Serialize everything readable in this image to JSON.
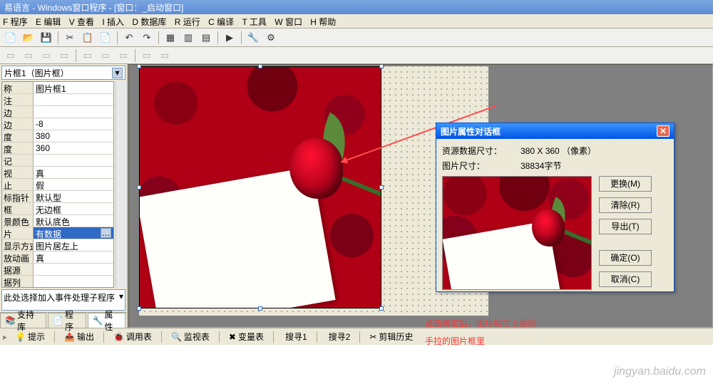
{
  "title": "易语言 - Windows窗口程序 - [窗口：_启动窗口]",
  "menu": [
    "F 程序",
    "E 编辑",
    "V 查看",
    "I 插入",
    "D 数据库",
    "R 运行",
    "C 编译",
    "T 工具",
    "W 窗口",
    "H 帮助"
  ],
  "combo": "片框1（图片框）",
  "props": [
    {
      "n": "称",
      "v": "图片框1"
    },
    {
      "n": "注",
      "v": ""
    },
    {
      "n": "边",
      "v": ""
    },
    {
      "n": "边",
      "v": "-8"
    },
    {
      "n": "度",
      "v": "380"
    },
    {
      "n": "度",
      "v": "360"
    },
    {
      "n": "记",
      "v": ""
    },
    {
      "n": "视",
      "v": "真"
    },
    {
      "n": "止",
      "v": "假"
    },
    {
      "n": "标指针",
      "v": "默认型"
    },
    {
      "n": "框",
      "v": "无边框"
    },
    {
      "n": "景颜色",
      "v": "默认底色"
    },
    {
      "n": "片",
      "v": "有数据",
      "sel": true
    },
    {
      "n": "显示方式",
      "v": "图片居左上"
    },
    {
      "n": "放动画",
      "v": "真"
    },
    {
      "n": "据源",
      "v": ""
    },
    {
      "n": "据列",
      "v": ""
    }
  ],
  "help": "此处选择加入事件处理子程序",
  "left_tabs": [
    {
      "icon": "📚",
      "label": "支持库"
    },
    {
      "icon": "📄",
      "label": "程序"
    },
    {
      "icon": "🔧",
      "label": "属性",
      "active": true
    }
  ],
  "dialog": {
    "title": "图片属性对话框",
    "res_label": "资源数据尺寸：",
    "res_value": "380 X 360 （像素）",
    "size_label": "图片尺寸：",
    "size_value": "38834字节",
    "btns": [
      "更换(M)",
      "清除(R)",
      "导出(T)",
      "确定(O)",
      "取消(C)"
    ]
  },
  "annot": "点击确定后，图片就\n手拉的图片框里",
  "annot_suffix": "在上面随",
  "bottom": [
    {
      "icon": "💡",
      "label": "提示"
    },
    {
      "icon": "📤",
      "label": "输出"
    },
    {
      "icon": "🐞",
      "label": "调用表"
    },
    {
      "icon": "🔍",
      "label": "监视表"
    },
    {
      "icon": "✖",
      "label": "变量表"
    },
    {
      "icon": "",
      "label": "搜寻1"
    },
    {
      "icon": "",
      "label": "搜寻2"
    },
    {
      "icon": "✂",
      "label": "剪辑历史"
    }
  ],
  "watermark": "jingyan.baidu.com"
}
